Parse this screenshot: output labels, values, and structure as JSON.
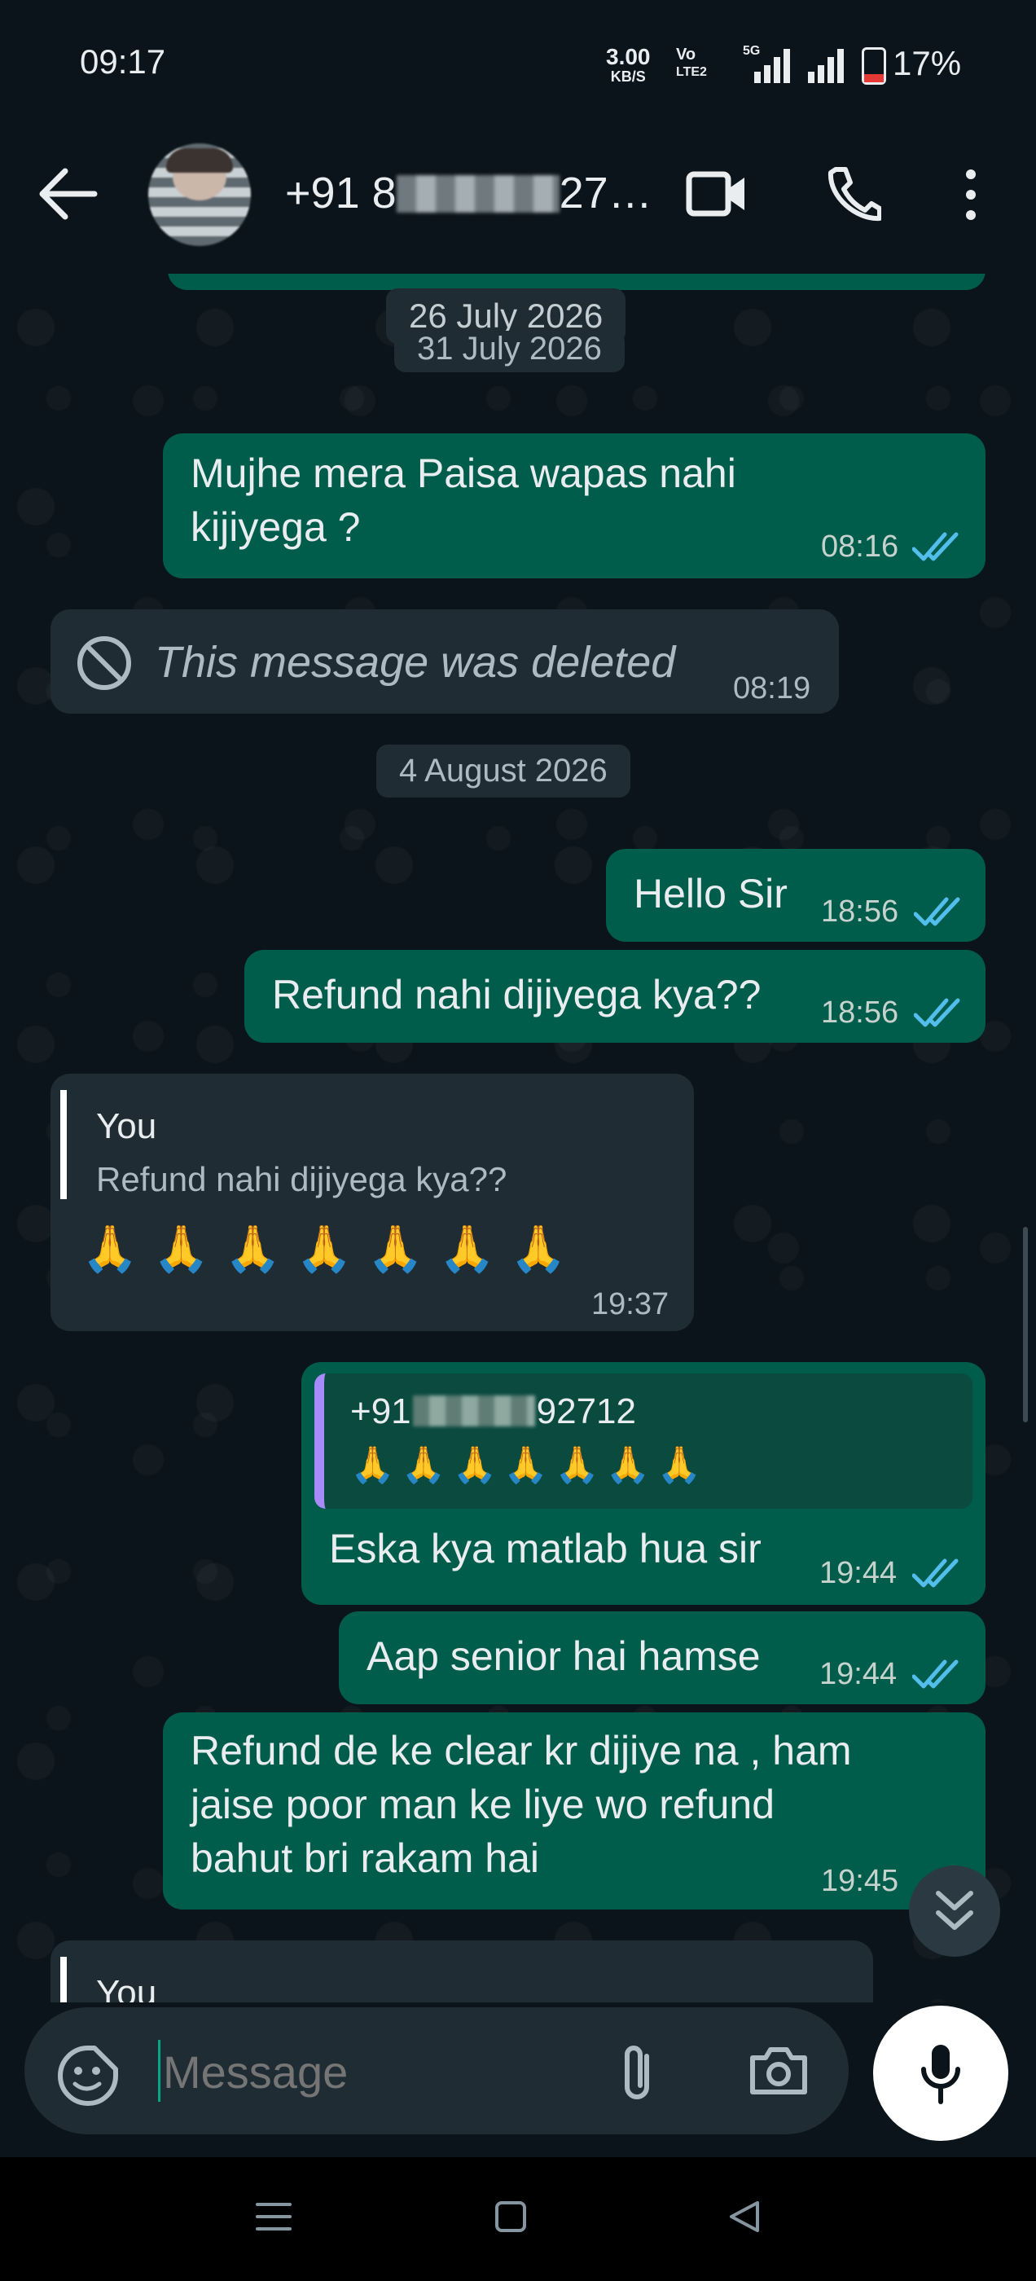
{
  "status_bar": {
    "time": "09:17",
    "net_rate_value": "3.00",
    "net_rate_unit": "KB/S",
    "volte_top": "Vo",
    "volte_bottom": "LTE2",
    "signal_label": "5G",
    "battery": "17%"
  },
  "header": {
    "contact_prefix": "+91 8",
    "contact_suffix": "27…",
    "icons": [
      "back-arrow-icon",
      "video-call-icon",
      "phone-call-icon",
      "more-vert-icon"
    ]
  },
  "chat": {
    "dates": [
      "26 July 2026",
      "31 July 2026",
      "4 August 2026"
    ],
    "messages": [
      {
        "dir": "out",
        "lines": [
          "Mujhe mera Paisa wapas nahi",
          "kijiyega ?"
        ],
        "time": "08:16"
      },
      {
        "dir": "in",
        "deleted": true,
        "text": "This message was deleted",
        "time": "08:19"
      },
      {
        "dir": "out",
        "text": "Hello Sir",
        "time": "18:56"
      },
      {
        "dir": "out",
        "text": "Refund nahi dijiyega kya??",
        "time": "18:56"
      },
      {
        "dir": "in",
        "quote_author": "You",
        "quote_text": "Refund nahi dijiyega kya??",
        "text": "🙏🙏🙏🙏🙏🙏🙏",
        "time": "19:37"
      },
      {
        "dir": "out",
        "quote_author_prefix": "+91",
        "quote_author_suffix": "92712",
        "quote_text": "🙏🙏🙏🙏🙏🙏🙏",
        "text": "Eska kya matlab hua sir",
        "time": "19:44"
      },
      {
        "dir": "out",
        "text": "Aap senior hai hamse",
        "time": "19:44"
      },
      {
        "dir": "out",
        "lines": [
          "Refund de ke clear kr dijiye na , ham",
          "jaise poor man ke liye wo refund",
          "bahut bri rakam hai"
        ],
        "time": "19:45"
      },
      {
        "dir": "in",
        "quote_author": "You"
      }
    ]
  },
  "composer": {
    "placeholder": "Message"
  },
  "colors": {
    "background": "#0b141a",
    "outgoing_bubble": "#005c4b",
    "incoming_bubble": "#202c33",
    "read_ticks": "#53bdeb",
    "accent": "#00a884"
  }
}
